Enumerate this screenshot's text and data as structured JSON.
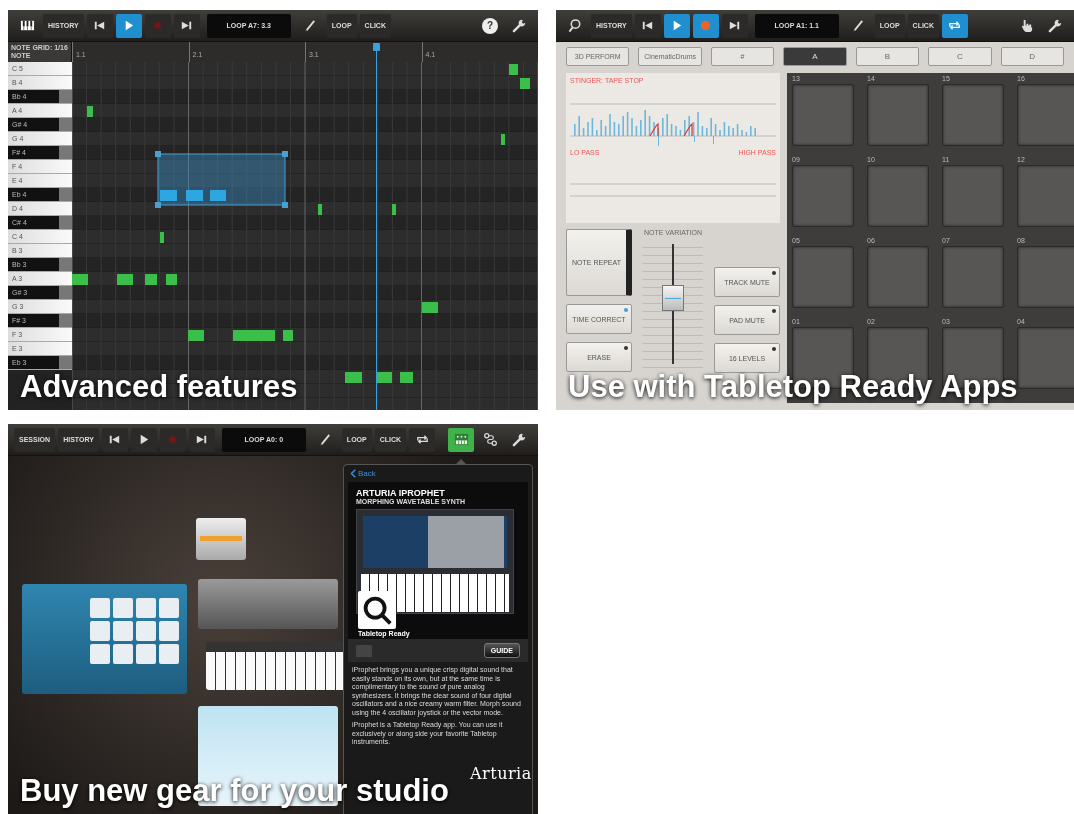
{
  "editor_screen": {
    "toolbar": {
      "left": [
        {
          "kind": "piano",
          "selected": false
        },
        {
          "kind": "text",
          "label": "HISTORY",
          "selected": false
        },
        {
          "kind": "skipback",
          "selected": false
        },
        {
          "kind": "play",
          "selected": true
        },
        {
          "kind": "record",
          "selected": false
        },
        {
          "kind": "skipforward",
          "selected": false
        },
        {
          "kind": "display",
          "label": "LOOP A7: 3.3"
        },
        {
          "kind": "pencil",
          "selected": false
        },
        {
          "kind": "text",
          "label": "LOOP",
          "selected": false
        },
        {
          "kind": "text",
          "label": "CLICK",
          "selected": false
        }
      ],
      "right": [
        {
          "kind": "help",
          "label": "?",
          "selected": false
        },
        {
          "kind": "wrench",
          "selected": false
        }
      ]
    },
    "note_grid_label": "NOTE GRID: 1/16 NOTE",
    "ruler": [
      "1.1",
      "2.1",
      "3.1",
      "4.1"
    ],
    "keys": [
      {
        "label": "C 5",
        "black": false
      },
      {
        "label": "B 4",
        "black": false
      },
      {
        "label": "Bb 4",
        "black": true
      },
      {
        "label": "A 4",
        "black": false
      },
      {
        "label": "G# 4",
        "black": true
      },
      {
        "label": "G 4",
        "black": false
      },
      {
        "label": "F# 4",
        "black": true
      },
      {
        "label": "F 4",
        "black": false
      },
      {
        "label": "E 4",
        "black": false
      },
      {
        "label": "Eb 4",
        "black": true
      },
      {
        "label": "D 4",
        "black": false
      },
      {
        "label": "C# 4",
        "black": true
      },
      {
        "label": "C 4",
        "black": false
      },
      {
        "label": "B 3",
        "black": false
      },
      {
        "label": "Bb 3",
        "black": true
      },
      {
        "label": "A 3",
        "black": false
      },
      {
        "label": "G# 3",
        "black": true
      },
      {
        "label": "G 3",
        "black": false
      },
      {
        "label": "F# 3",
        "black": true
      },
      {
        "label": "F 3",
        "black": false
      },
      {
        "label": "E 3",
        "black": false
      },
      {
        "label": "Eb 3",
        "black": true
      }
    ],
    "caption": "Advanced features"
  },
  "pads_screen": {
    "toolbar": {
      "left": [
        {
          "kind": "zoom",
          "selected": false
        },
        {
          "kind": "text",
          "label": "HISTORY",
          "selected": false
        },
        {
          "kind": "skipback",
          "selected": false
        },
        {
          "kind": "play",
          "selected": true
        },
        {
          "kind": "record",
          "selected": true
        },
        {
          "kind": "skipforward",
          "selected": false
        },
        {
          "kind": "display",
          "label": "LOOP A1: 1.1"
        },
        {
          "kind": "pencil",
          "selected": false
        },
        {
          "kind": "text",
          "label": "LOOP",
          "selected": false
        },
        {
          "kind": "text",
          "label": "CLICK",
          "selected": false
        },
        {
          "kind": "cycle",
          "selected": true
        }
      ],
      "right": [
        {
          "kind": "hand",
          "selected": false
        },
        {
          "kind": "wrench",
          "selected": false
        }
      ]
    },
    "banks": [
      {
        "label": "3D PERFORM",
        "selected": false
      },
      {
        "label": "CinematicDrums",
        "selected": false
      },
      {
        "label": "#",
        "selected": false
      },
      {
        "label": "A",
        "selected": true
      },
      {
        "label": "B",
        "selected": false
      },
      {
        "label": "C",
        "selected": false
      },
      {
        "label": "D",
        "selected": false
      }
    ],
    "effect": {
      "title": "STINGER: TAPE STOP",
      "low_label": "LO PASS",
      "high_label": "HIGH PASS"
    },
    "left_buttons": [
      {
        "kind": "latch",
        "label": "NOTE REPEAT",
        "on": true
      },
      {
        "kind": "toggle",
        "label": "TIME CORRECT",
        "on": true
      },
      {
        "kind": "toggle",
        "label": "ERASE",
        "on": false
      }
    ],
    "slider": {
      "label": "NOTE VARIATION",
      "level": 0.55
    },
    "right_buttons": [
      {
        "kind": "toggle",
        "label": "TRACK MUTE",
        "on": false
      },
      {
        "kind": "toggle",
        "label": "PAD MUTE",
        "on": false
      },
      {
        "kind": "toggle",
        "label": "16 LEVELS",
        "on": false
      }
    ],
    "pads": [
      {
        "number": "13"
      },
      {
        "number": "14"
      },
      {
        "number": "15"
      },
      {
        "number": "16"
      },
      {
        "number": "09"
      },
      {
        "number": "10"
      },
      {
        "number": "11"
      },
      {
        "number": "12"
      },
      {
        "number": "05"
      },
      {
        "number": "06"
      },
      {
        "number": "07"
      },
      {
        "number": "08"
      },
      {
        "number": "01"
      },
      {
        "number": "02"
      },
      {
        "number": "03"
      },
      {
        "number": "04"
      }
    ],
    "caption": "Use with Tabletop Ready Apps"
  },
  "store_screen": {
    "toolbar": {
      "left": [
        {
          "kind": "text",
          "label": "SESSION",
          "selected": false
        },
        {
          "kind": "text",
          "label": "HISTORY",
          "selected": false
        },
        {
          "kind": "skipback",
          "selected": false
        },
        {
          "kind": "play",
          "selected": false
        },
        {
          "kind": "record",
          "selected": false
        },
        {
          "kind": "skipforward",
          "selected": false
        },
        {
          "kind": "display",
          "label": "LOOP A0: 0"
        },
        {
          "kind": "pencil",
          "selected": false
        },
        {
          "kind": "text",
          "label": "LOOP",
          "selected": false
        },
        {
          "kind": "text",
          "label": "CLICK",
          "selected": false
        },
        {
          "kind": "cycle",
          "selected": false
        }
      ],
      "right": [
        {
          "kind": "keyboard",
          "selected": true
        },
        {
          "kind": "routing",
          "selected": false
        },
        {
          "kind": "wrench",
          "selected": false
        }
      ]
    },
    "popover": {
      "back": "Back",
      "title": "ARTURIA IPROPHET",
      "subtitle": "MORPHING WAVETABLE SYNTH",
      "badge": "Tabletop Ready",
      "guide": "GUIDE",
      "paragraphs": [
        "iProphet brings you a unique crisp digital sound that easily stands on its own, but at the same time is complimentary to the sound of pure analog synthesizers. It brings the clear sound of four digital oscillators and a nice creamy warm filter. Morph sound using the 4 oscillator joystick or the vector mode.",
        "iProphet is a Tabletop Ready app. You can use it exclusively or along side your favorite Tabletop instruments."
      ]
    },
    "logo": "Arturia",
    "caption": "Buy new gear for your studio"
  }
}
